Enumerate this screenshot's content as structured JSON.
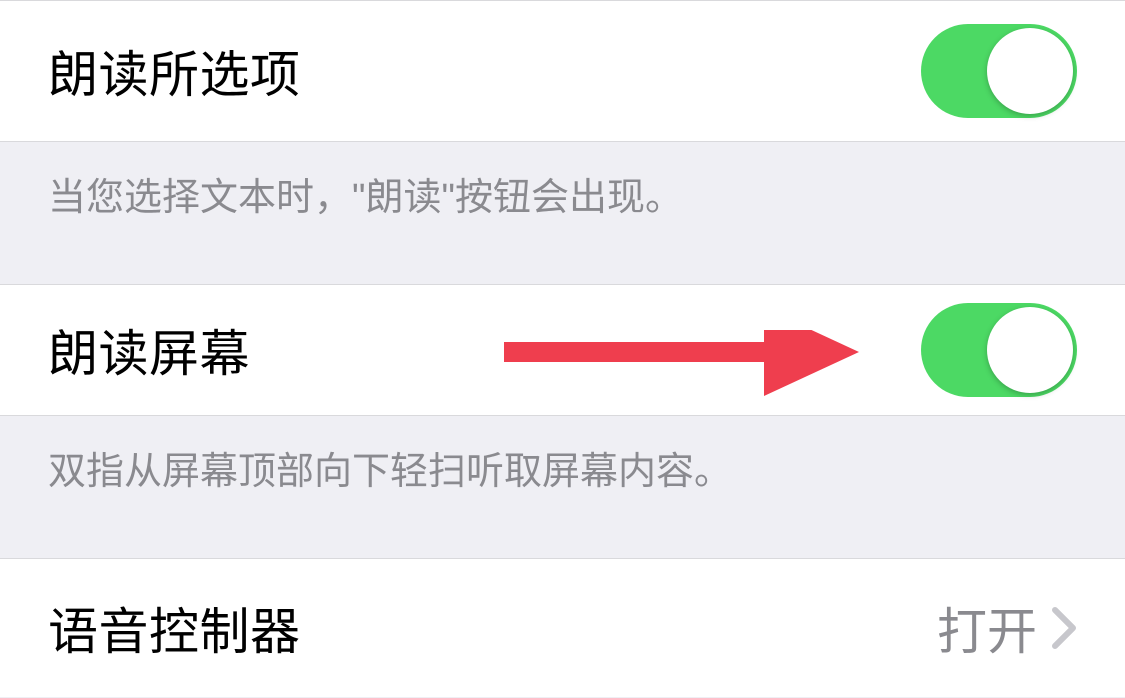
{
  "settings": {
    "speak_selection": {
      "label": "朗读所选项",
      "enabled": true,
      "description": "当您选择文本时，\"朗读\"按钮会出现。"
    },
    "speak_screen": {
      "label": "朗读屏幕",
      "enabled": true,
      "description": "双指从屏幕顶部向下轻扫听取屏幕内容。"
    },
    "voice_controller": {
      "label": "语音控制器",
      "value": "打开"
    }
  },
  "colors": {
    "toggle_on": "#4cd964",
    "arrow": "#ef3e4e",
    "background": "#efeff4",
    "cell_background": "#ffffff",
    "secondary_text": "#8a8a8f"
  }
}
